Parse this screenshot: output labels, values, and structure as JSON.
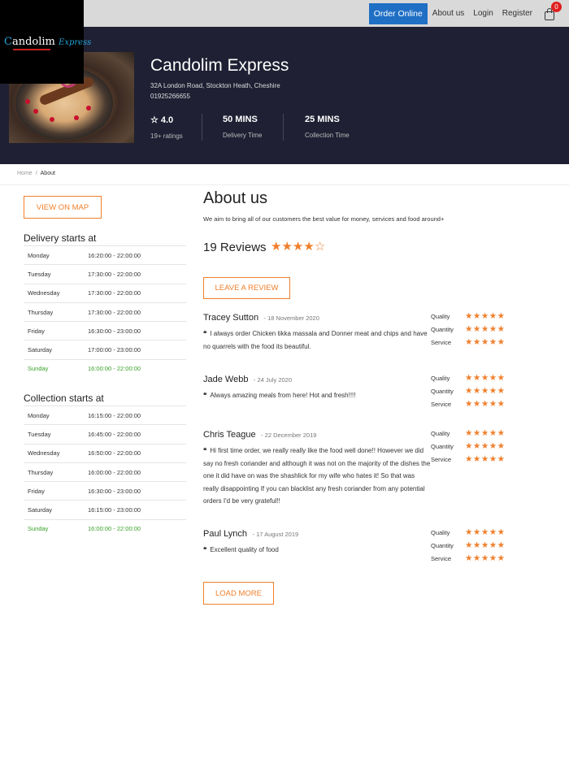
{
  "nav": {
    "order_online": "Order Online",
    "about": "About us",
    "login": "Login",
    "register": "Register",
    "cart_count": "0"
  },
  "logo": {
    "first": "C",
    "rest": "andolim",
    "express": "Express"
  },
  "restaurant": {
    "name": "Candolim Express",
    "address": "32A London Road, Stockton Heath, Cheshire",
    "phone": "01925266655",
    "rating": "4.0",
    "ratings_count": "19+ ratings",
    "delivery_time": "50 MINS",
    "delivery_label": "Delivery Time",
    "collection_time": "25 MINS",
    "collection_label": "Collection Time"
  },
  "breadcrumb": {
    "home": "Home",
    "sep": "/",
    "current": "About"
  },
  "left": {
    "map_button": "VIEW ON MAP",
    "delivery_title": "Delivery starts at",
    "delivery": [
      {
        "day": "Monday",
        "hours": "16:20:00 - 22:00:00"
      },
      {
        "day": "Tuesday",
        "hours": "17:30:00 - 22:00:00"
      },
      {
        "day": "Wednesday",
        "hours": "17:30:00 - 22:00:00"
      },
      {
        "day": "Thursday",
        "hours": "17:30:00 - 22:00:00"
      },
      {
        "day": "Friday",
        "hours": "16:30:00 - 23:00:00"
      },
      {
        "day": "Saturday",
        "hours": "17:00:00 - 23:00:00"
      },
      {
        "day": "Sunday",
        "hours": "16:00:00 - 22:00:00"
      }
    ],
    "collection_title": "Collection starts at",
    "collection": [
      {
        "day": "Monday",
        "hours": "16:15:00 - 22:00:00"
      },
      {
        "day": "Tuesday",
        "hours": "16:45:00 - 22:00:00"
      },
      {
        "day": "Wednesday",
        "hours": "16:50:00 - 22:00:00"
      },
      {
        "day": "Thursday",
        "hours": "16:00:00 - 22:00:00"
      },
      {
        "day": "Friday",
        "hours": "16:30:00 - 23:00:00"
      },
      {
        "day": "Saturday",
        "hours": "16:15:00 - 23:00:00"
      },
      {
        "day": "Sunday",
        "hours": "16:00:00 - 22:00:00"
      }
    ]
  },
  "about": {
    "title": "About us",
    "text": "We aim to bring all of our customers the best value for money, services and food around+",
    "reviews_title": "19 Reviews",
    "rating_stars": 4,
    "leave_review": "LEAVE A REVIEW",
    "load_more": "LOAD MORE",
    "rating_labels": [
      "Quality",
      "Quantity",
      "Service"
    ]
  },
  "reviews": [
    {
      "name": "Tracey Sutton",
      "date": "- 18 November 2020",
      "text": "I always order Chicken tikka massala and Donner meat and chips and have no quarrels with the food its beautiful.",
      "quality": 5,
      "quantity": 5,
      "service": 5
    },
    {
      "name": "Jade Webb",
      "date": "- 24 July 2020",
      "text": "Always amazing meals from here! Hot and fresh!!!!",
      "quality": 5,
      "quantity": 5,
      "service": 5
    },
    {
      "name": "Chris Teague",
      "date": "- 22 December 2019",
      "text": "Hi first time order, we really really like the food well done!! However we did say no fresh coriander and although it was not on the majority of the dishes the one it did have on was the shashlick for my wife who hates it! So that was really disappointing If you can blacklist any fresh coriander from any potential orders I'd be very grateful!!",
      "quality": 5,
      "quantity": 5,
      "service": 5
    },
    {
      "name": "Paul Lynch",
      "date": "- 17 August 2019",
      "text": "Excellent quality of food",
      "quality": 5,
      "quantity": 5,
      "service": 5
    }
  ],
  "colors": {
    "accent": "#f07f2b",
    "hero_bg": "#1f2033",
    "order_blue": "#1f6fc5",
    "today_green": "#3aa02a"
  }
}
